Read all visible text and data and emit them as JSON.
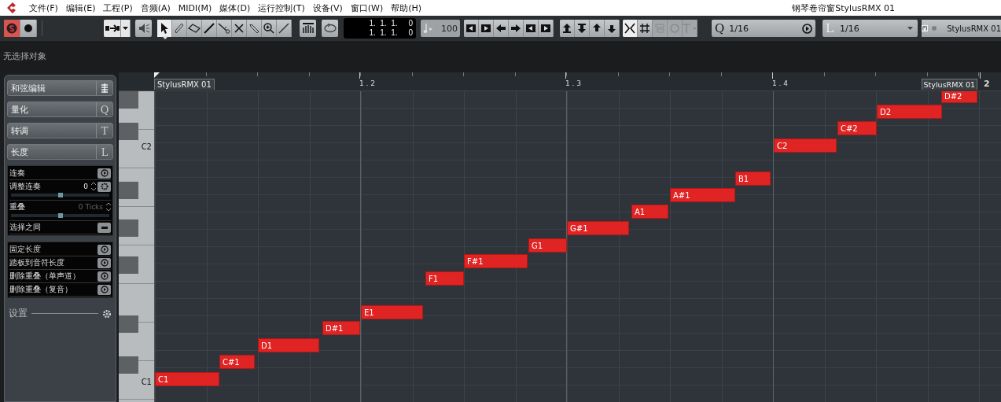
{
  "menu_bar": {
    "items": [
      "文件(F)",
      "编辑(E)",
      "工程(P)",
      "音频(A)",
      "MIDI(M)",
      "媒体(D)",
      "运行控制(T)",
      "设备(V)",
      "窗口(W)",
      "帮助(H)"
    ]
  },
  "window": {
    "title": "钢琴卷帘窗StylusRMX 01"
  },
  "toolbar": {
    "solo": {
      "on": true
    },
    "tools": [
      {
        "kind": "arrow",
        "selected": true
      },
      {
        "kind": "pencil",
        "selected": false
      },
      {
        "kind": "eraser",
        "selected": false
      },
      {
        "kind": "knife",
        "selected": false
      },
      {
        "kind": "glue",
        "selected": false
      },
      {
        "kind": "mute",
        "selected": false
      },
      {
        "kind": "zoom",
        "selected": false
      },
      {
        "kind": "magnifier",
        "selected": false
      },
      {
        "kind": "line",
        "selected": false
      }
    ],
    "position": [
      "1.  1.  1.     0",
      "1.  1.  1.     0"
    ],
    "velocity": "100",
    "quantize": "1/16",
    "quantize_letter": "Q",
    "length_letter": "L",
    "length": "1/16",
    "track": "StylusRMX 01"
  },
  "info_line": "无选择对象",
  "inspector": {
    "sections": [
      {
        "label": "和弦编辑",
        "kind": "icon"
      },
      {
        "label": "量化",
        "key": "Q"
      },
      {
        "label": "转调",
        "key": "T"
      },
      {
        "label": "长度",
        "key": "L"
      }
    ],
    "legato": [
      {
        "label": "连奏",
        "kind": "button"
      },
      {
        "label": "调整连奏",
        "kind": "spin",
        "value": "0",
        "level": 0.5
      },
      {
        "label": "重叠",
        "kind": "spin",
        "value": "0 Ticks",
        "disabled": true,
        "level": 0.5
      },
      {
        "label": "选择之间",
        "kind": "toggle"
      }
    ],
    "length_actions": [
      "固定长度",
      "踏板到音符长度",
      "删除重叠（单声道）",
      "删除重叠（复音）"
    ],
    "settings": "设置"
  },
  "ruler": {
    "part_labels": [
      "StylusRMX 01",
      "StylusRMX 01"
    ],
    "bars": [
      "1 . 2",
      "1 . 3",
      "1 . 4",
      "2"
    ]
  },
  "keyboard": {
    "labels": [
      "C2",
      "C1"
    ]
  },
  "notes": [
    {
      "name": "C1"
    },
    {
      "name": "C#1"
    },
    {
      "name": "D1"
    },
    {
      "name": "D#1"
    },
    {
      "name": "E1"
    },
    {
      "name": "F1"
    },
    {
      "name": "F#1"
    },
    {
      "name": "G1"
    },
    {
      "name": "G#1"
    },
    {
      "name": "A1"
    },
    {
      "name": "A#1"
    },
    {
      "name": "B1"
    },
    {
      "name": "C2"
    },
    {
      "name": "C#2"
    },
    {
      "name": "D2"
    },
    {
      "name": "D#2"
    }
  ]
}
